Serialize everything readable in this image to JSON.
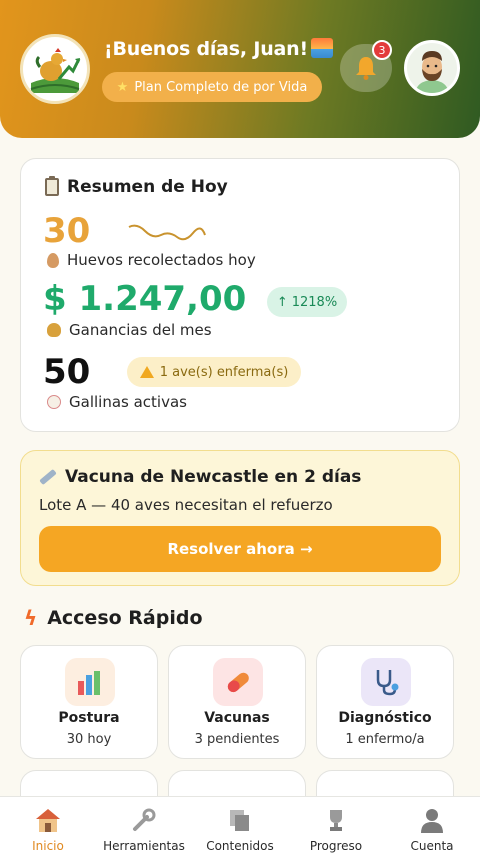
{
  "header": {
    "greeting": "¡Buenos días, Juan!",
    "plan_label": "Plan Completo de por Vida",
    "notification_count": "3"
  },
  "summary": {
    "title": "Resumen de Hoy",
    "eggs_value": "30",
    "eggs_label": "Huevos recolectados hoy",
    "earnings_value": "$ 1.247,00",
    "earnings_change": "1218%",
    "earnings_label": "Ganancias del mes",
    "hens_value": "50",
    "sick_label": "1 ave(s) enferma(s)",
    "hens_label": "Gallinas activas"
  },
  "alert": {
    "title": "Vacuna de Newcastle en 2 días",
    "subtitle": "Lote A — 40 aves necesitan el refuerzo",
    "button_label": "Resolver ahora →"
  },
  "quick_access": {
    "title": "Acceso Rápido",
    "tiles": [
      {
        "label": "Postura",
        "sub": "30 hoy",
        "icon": "bar-chart-icon"
      },
      {
        "label": "Vacunas",
        "sub": "3 pendientes",
        "icon": "pill-icon"
      },
      {
        "label": "Diagnóstico",
        "sub": "1 enfermo/a",
        "icon": "stethoscope-icon"
      }
    ]
  },
  "nav": {
    "items": [
      {
        "label": "Inicio",
        "icon": "home-icon"
      },
      {
        "label": "Herramientas",
        "icon": "wrench-icon"
      },
      {
        "label": "Contenidos",
        "icon": "documents-icon"
      },
      {
        "label": "Progreso",
        "icon": "trophy-icon"
      },
      {
        "label": "Cuenta",
        "icon": "person-icon"
      }
    ]
  },
  "colors": {
    "accent": "#f5a623",
    "money": "#1faa6b",
    "eggs": "#e8a33a"
  }
}
